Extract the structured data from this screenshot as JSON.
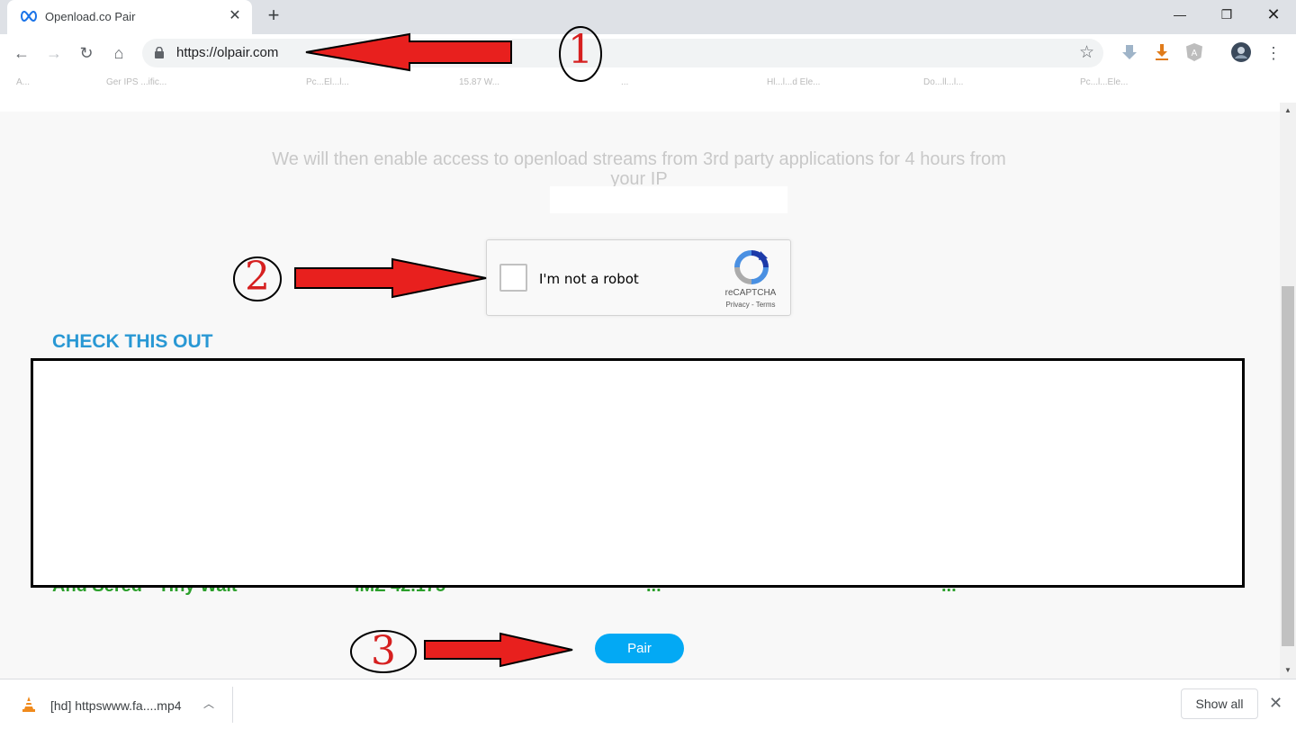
{
  "tab": {
    "title": "Openload.co Pair",
    "favicon": "infinity-icon"
  },
  "toolbar": {
    "url": "https://olpair.com"
  },
  "bookmarks": {
    "items": [
      "A...",
      "Ger IPS ...ific...",
      "Pc...El...l...",
      "15.87 W...",
      "...",
      "Hl...l...d Ele...",
      "Do...ll...l...",
      "Pc...l...Ele..."
    ]
  },
  "page": {
    "message": "We will then enable access to openload streams from 3rd party applications for 4 hours from your IP",
    "recaptcha": {
      "label": "I'm not a robot",
      "brand": "reCAPTCHA",
      "links": "Privacy - Terms"
    },
    "check_heading": "CHECK THIS OUT",
    "green_row": [
      "And Sered - Tiny Walt",
      "IMZ 42.175",
      "...",
      "..."
    ],
    "pair_label": "Pair"
  },
  "annotations": {
    "one": "1",
    "two": "2",
    "three": "3",
    "arrow_color": "#e8201e"
  },
  "download": {
    "filename": "[hd] httpswww.fa....mp4",
    "show_all": "Show all"
  },
  "colors": {
    "heading": "#2998d4",
    "pair_button": "#03a9f4",
    "green_text": "#2ca02c"
  }
}
